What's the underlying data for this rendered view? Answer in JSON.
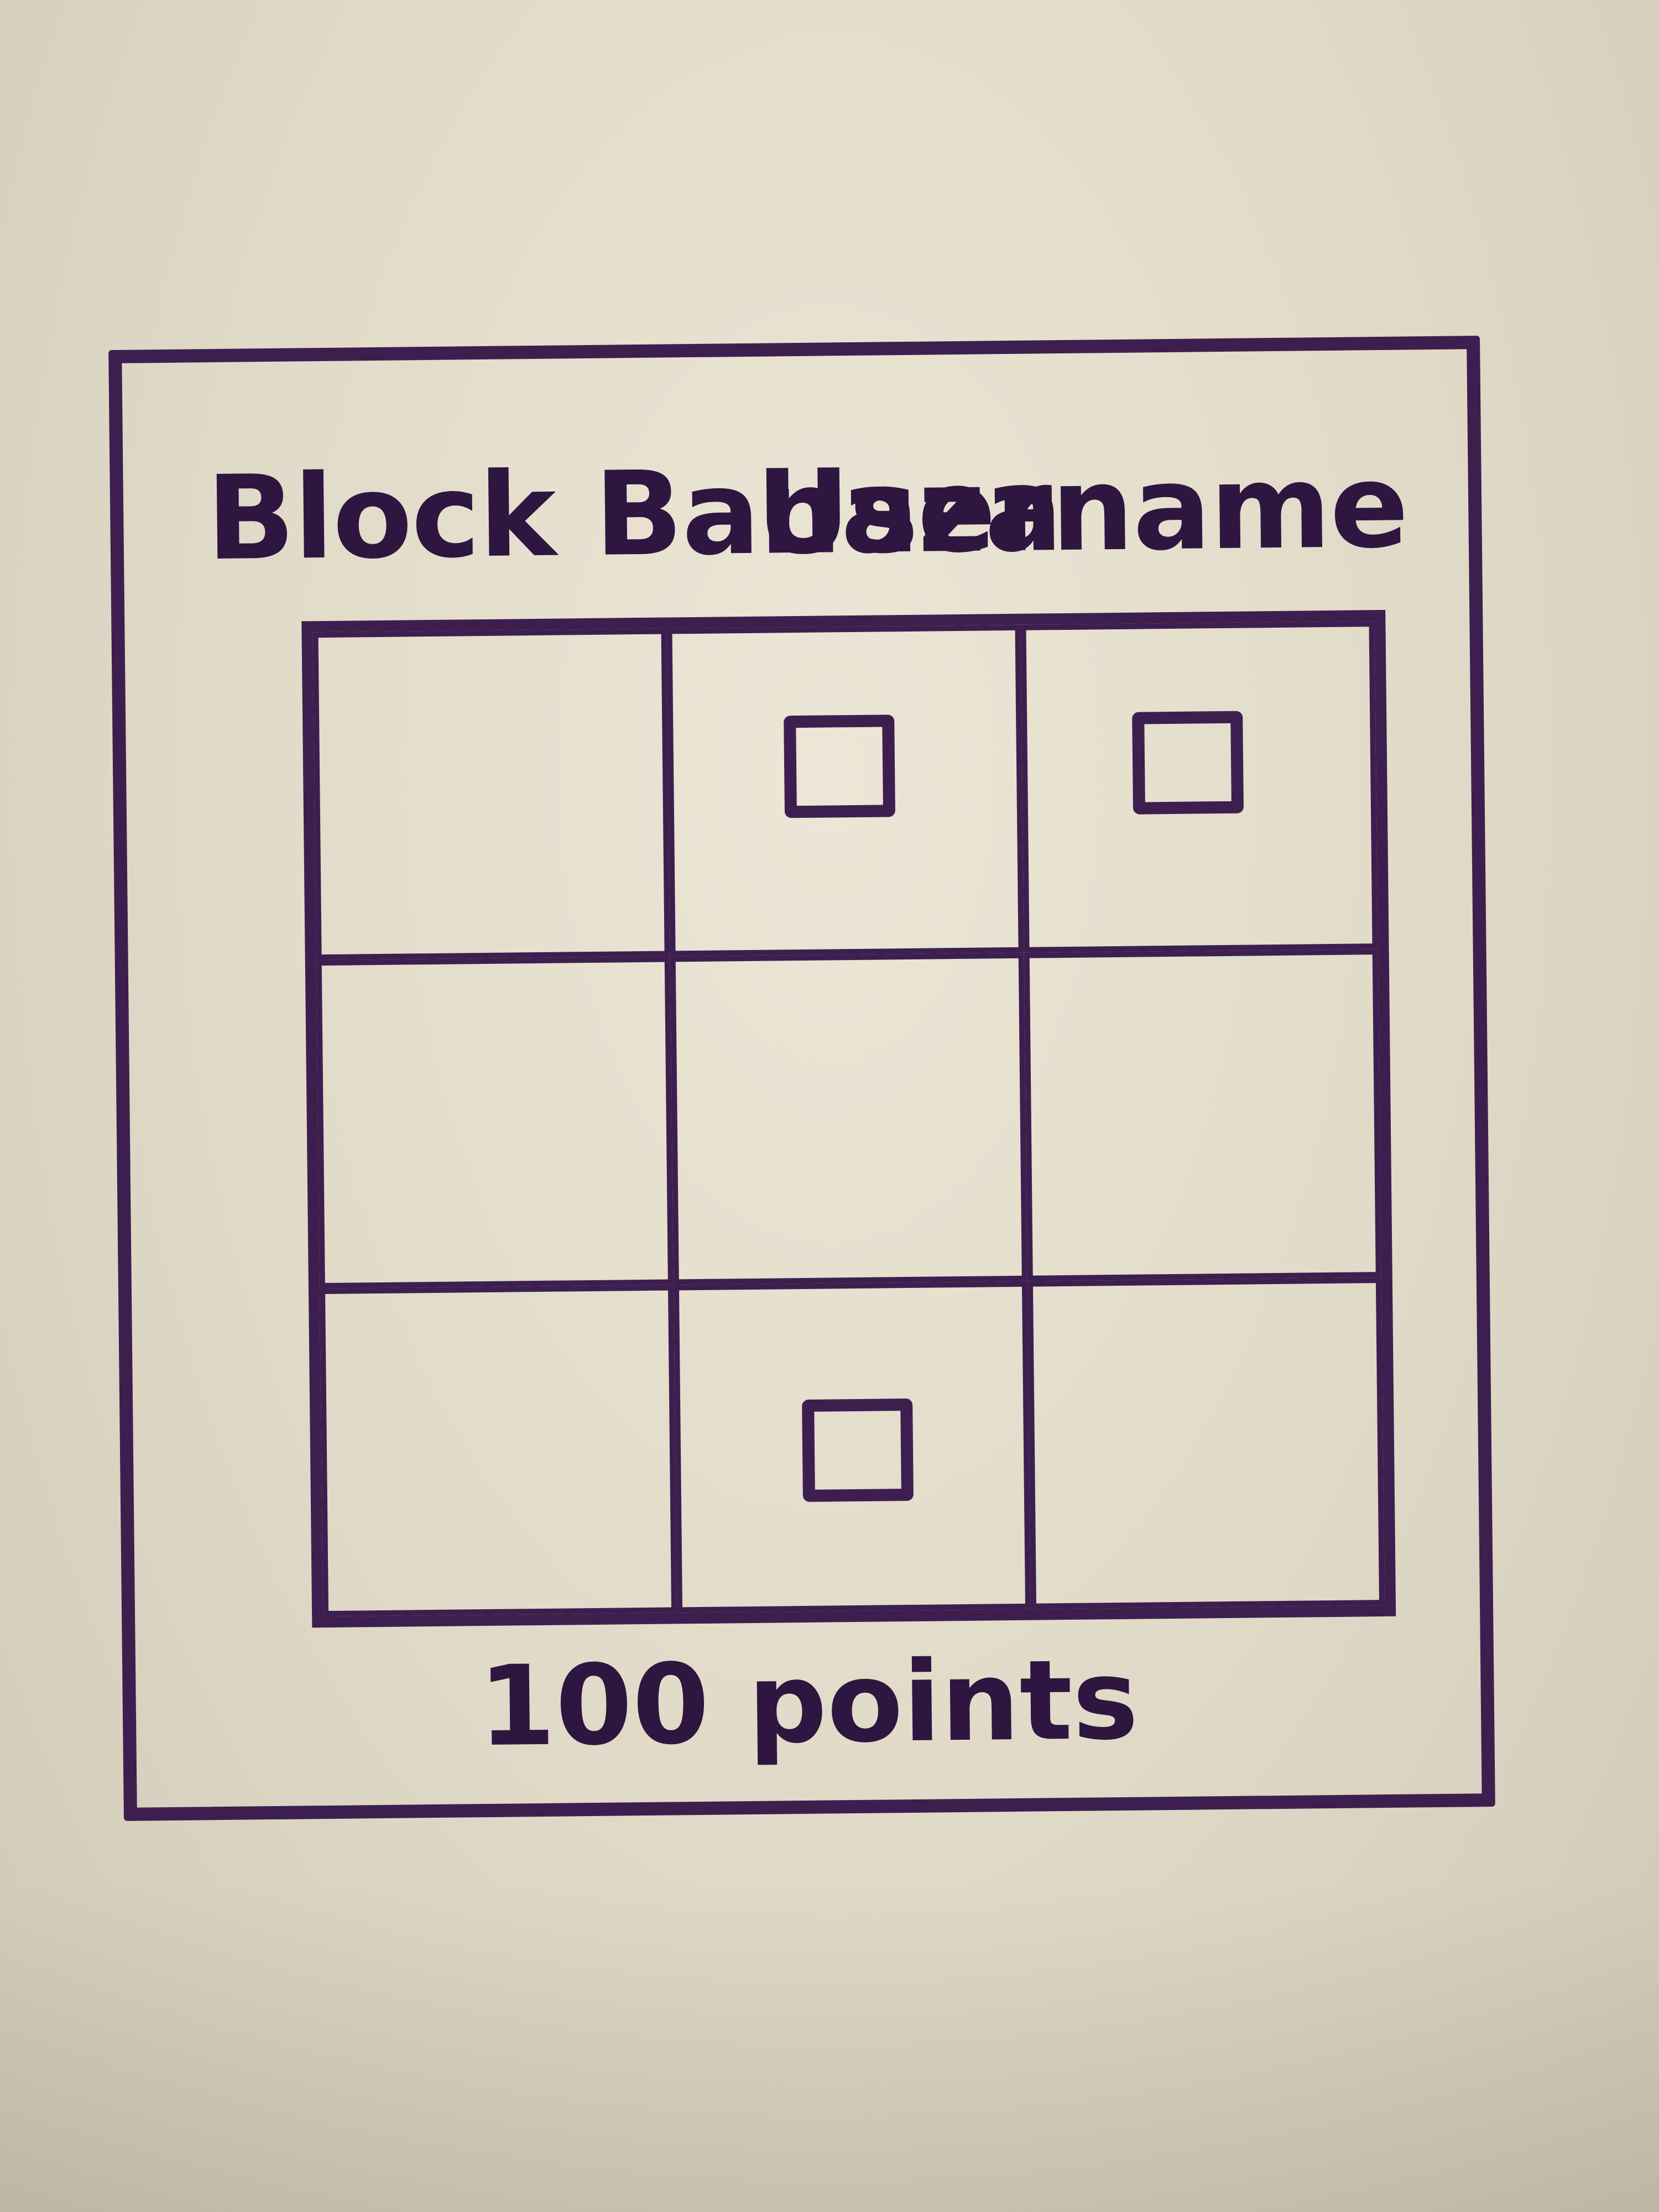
{
  "header": {
    "title": "Block Banaza",
    "username": "Username"
  },
  "grid": {
    "rows": 3,
    "columns": 3,
    "cells": [
      {
        "row": 1,
        "col": 1,
        "has_block": false
      },
      {
        "row": 1,
        "col": 2,
        "has_block": true
      },
      {
        "row": 1,
        "col": 3,
        "has_block": true
      },
      {
        "row": 2,
        "col": 1,
        "has_block": false
      },
      {
        "row": 2,
        "col": 2,
        "has_block": false
      },
      {
        "row": 2,
        "col": 3,
        "has_block": false
      },
      {
        "row": 3,
        "col": 1,
        "has_block": false
      },
      {
        "row": 3,
        "col": 2,
        "has_block": true
      },
      {
        "row": 3,
        "col": 3,
        "has_block": false
      }
    ]
  },
  "footer": {
    "score_text": "100 points"
  },
  "colors": {
    "ink": "#3d1f4f",
    "board": "#e6e0cf"
  }
}
